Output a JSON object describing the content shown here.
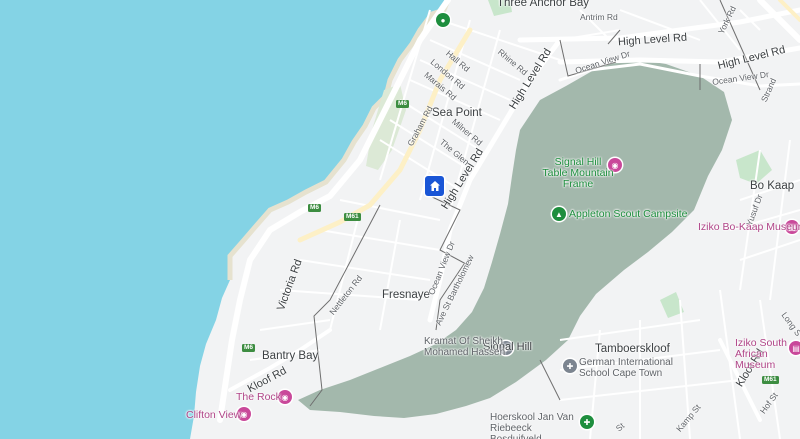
{
  "map": {
    "neighborhoods": {
      "sea_point": "Sea Point",
      "fresnaye": "Fresnaye",
      "bantry_bay": "Bantry Bay",
      "bo_kaap": "Bo Kaap",
      "tamboerskloof": "Tamboerskloof",
      "three_anchor_bay": "Three Anchor Bay"
    },
    "roads": {
      "high_level_rd_top": "High Level Rd",
      "high_level_rd_right": "High Level Rd",
      "high_level_rd_diag": "High Level Rd",
      "high_level_rd_center": "High Level Rd",
      "ocean_view_dr_top": "Ocean View Dr",
      "ocean_view_dr_right": "Ocean View Dr",
      "ocean_view_dr_center": "Ocean View Dr",
      "ave_st_bartholomew": "Ave St Bartholomew",
      "victoria_rd": "Victoria Rd",
      "kloof_rd": "Kloof Rd",
      "kloof_rd_right": "Kloof Rd",
      "hall_rd": "Hall Rd",
      "london_rd": "London Rd",
      "marais_rd": "Marais Rd",
      "rhine_rd": "Rhine Rd",
      "graham_rd": "Graham Rd",
      "milner_rd": "Milner Rd",
      "the_glen": "The Glen",
      "antrim_rd": "Antrim Rd",
      "york_rd": "York Rd",
      "nettleton_rd": "Nettleton Rd",
      "yusuf_dr": "Yusuf Dr",
      "kamp_st": "Kamp St",
      "hof_st": "Hof St",
      "long_st": "Long S",
      "st_street": "St",
      "strand": "Strand"
    },
    "highway_shields": [
      "M6",
      "M6",
      "M61",
      "M6",
      "M61"
    ],
    "pois": {
      "signal_hill_table_mountain_frame": "Signal Hill Table Mountain Frame",
      "appleton_scout_campsite": "Appleton Scout Campsite",
      "iziko_bo_kaap_museum": "Iziko Bo-Kaap Museum",
      "iziko_south_african_museum": "Iziko South African Museum",
      "signal_hill": "Signal Hill",
      "kramat": "Kramat Of Sheikh Mohamed Hassen",
      "german_school": "German International School Cape Town",
      "hoerskool": "Hoerskool Jan Van Riebeeck Bosduifveld",
      "the_rock": "The Rock",
      "clifton_view": "Clifton View"
    },
    "colors": {
      "water": "#84d3e5",
      "land": "#f2f3f4",
      "park": "#a3b8ac",
      "green_space": "#c8e6cb",
      "road": "#ffffff",
      "major_road": "#fdf0c6",
      "boundary": "#6e6e6e",
      "marker": "#1a56d6"
    },
    "marker_icon": "home-icon"
  }
}
